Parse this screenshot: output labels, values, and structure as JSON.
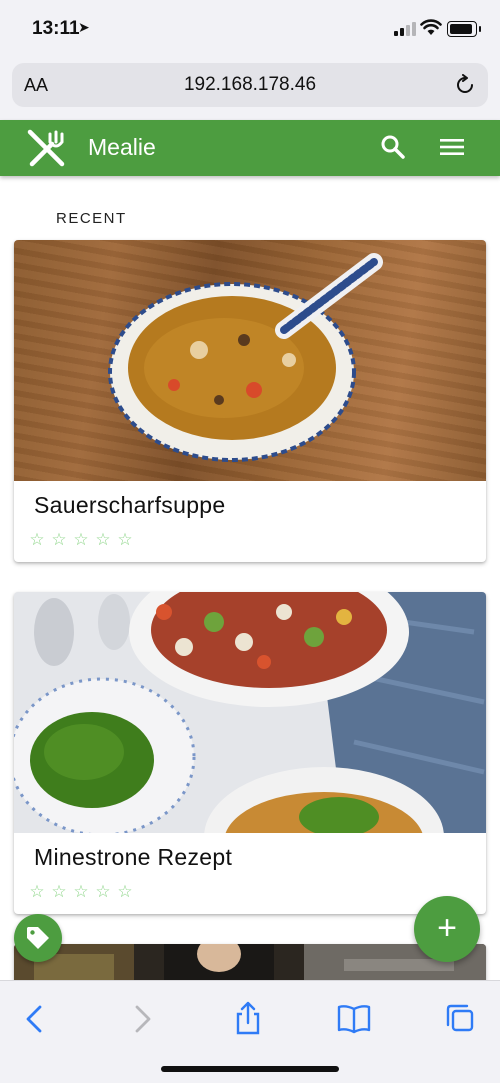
{
  "status_bar": {
    "time": "13:11",
    "location_glyph": "➤"
  },
  "browser": {
    "text_size_label": "AA",
    "url": "192.168.178.46",
    "icons": [
      "reload-icon"
    ]
  },
  "app_bar": {
    "title": "Mealie",
    "icons": [
      "fork-knife-logo-icon",
      "search-icon",
      "hamburger-menu-icon"
    ],
    "color": "#4d9d40"
  },
  "section": {
    "label": "RECENT"
  },
  "recipes": [
    {
      "name": "Sauerscharfsuppe",
      "rating_stars": [
        "☆",
        "☆",
        "☆",
        "☆",
        "☆"
      ]
    },
    {
      "name": "Minestrone Rezept",
      "rating_stars": [
        "☆",
        "☆",
        "☆",
        "☆",
        "☆"
      ]
    }
  ],
  "fab": {
    "add_label": "+",
    "tag_icon": "tag-icon"
  },
  "toolbar": {
    "icons": [
      "back-icon",
      "forward-icon",
      "share-icon",
      "bookmarks-icon",
      "tabs-icon"
    ]
  },
  "colors": {
    "accent": "#4d9d40",
    "star": "#8fd68a"
  }
}
